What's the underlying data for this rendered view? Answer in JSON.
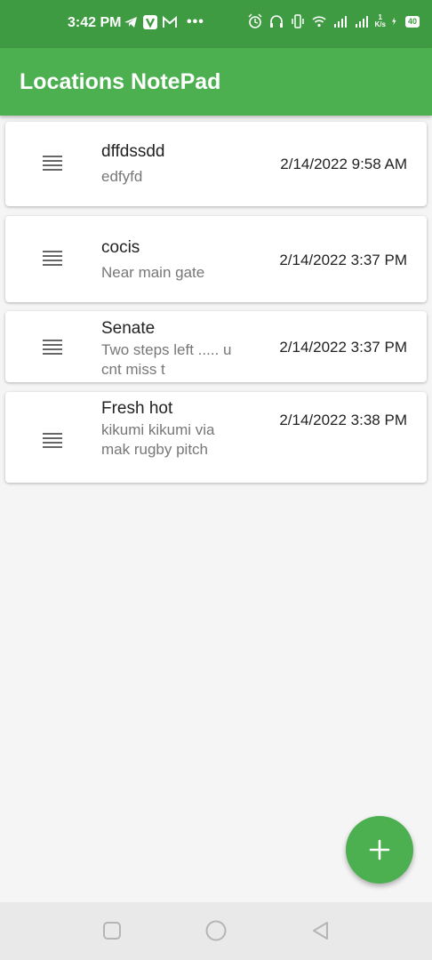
{
  "status_bar": {
    "time": "3:42 PM",
    "dots": "•••",
    "net_speed_value": "1",
    "net_speed_unit": "K/s",
    "battery": "40",
    "icons": [
      "telegram-icon",
      "vpn-icon",
      "gmail-icon",
      "alarm-icon",
      "headset-icon",
      "vibrate-icon",
      "wifi-icon",
      "signal-icon",
      "signal-icon-2",
      "charging-icon"
    ]
  },
  "app_bar": {
    "title": "Locations NotePad"
  },
  "notes": [
    {
      "title": "dffdssdd",
      "subtitle": "edfyfd",
      "date": "2/14/2022 9:58 AM"
    },
    {
      "title": "cocis",
      "subtitle": "Near main gate",
      "date": "2/14/2022 3:37 PM"
    },
    {
      "title": "Senate",
      "subtitle": "Two steps left ..... u cnt miss t",
      "date": "2/14/2022 3:37 PM"
    },
    {
      "title": "Fresh hot",
      "subtitle": "kikumi kikumi via mak rugby pitch",
      "date": "2/14/2022 3:38 PM"
    }
  ],
  "fab": {
    "icon": "plus-icon"
  },
  "nav_bar": {
    "icons": [
      "recents-icon",
      "home-icon",
      "back-icon"
    ]
  },
  "colors": {
    "primary": "#4caf50",
    "status_bar": "#3f9b42",
    "background": "#f5f5f5"
  }
}
